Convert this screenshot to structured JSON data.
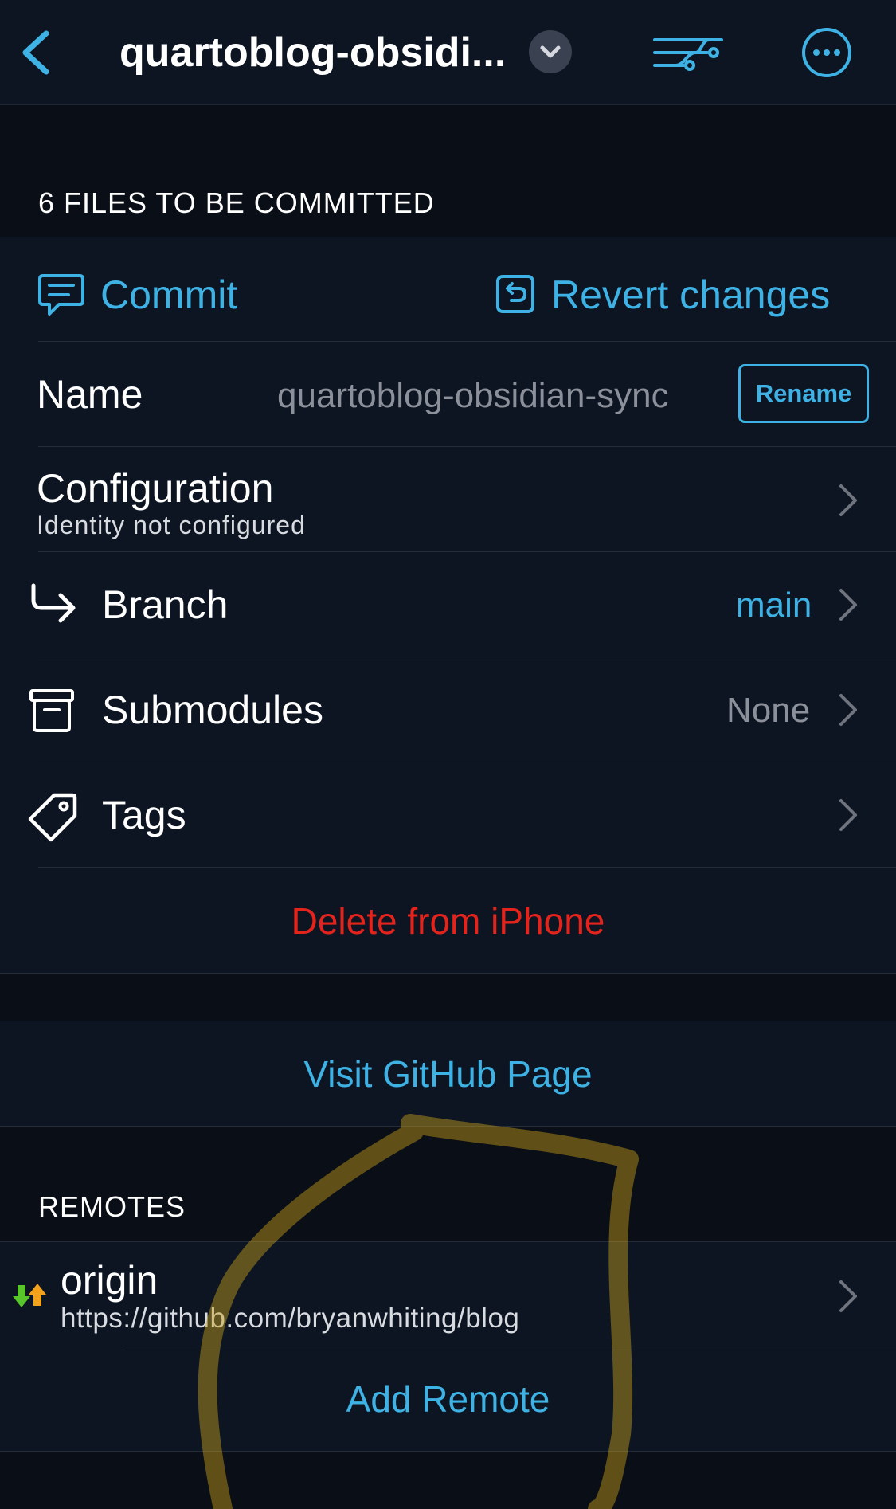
{
  "nav": {
    "title": "quartoblog-obsidi...",
    "back_icon": "chevron-left-icon",
    "dropdown_icon": "chevron-down-icon",
    "filter_icon": "git-filter-icon",
    "more_icon": "ellipsis-circle-icon"
  },
  "commit_section": {
    "header": "6 FILES TO BE COMMITTED",
    "commit_label": "Commit",
    "revert_label": "Revert changes"
  },
  "repo": {
    "name_label": "Name",
    "name_value": "quartoblog-obsidian-sync",
    "rename_label": "Rename",
    "configuration_label": "Configuration",
    "configuration_subtitle": "Identity not configured",
    "branch_label": "Branch",
    "branch_value": "main",
    "submodules_label": "Submodules",
    "submodules_value": "None",
    "tags_label": "Tags",
    "delete_label": "Delete from iPhone"
  },
  "github": {
    "visit_label": "Visit GitHub Page"
  },
  "remotes": {
    "header": "REMOTES",
    "items": [
      {
        "name": "origin",
        "url": "https://github.com/bryanwhiting/blog"
      }
    ],
    "add_label": "Add Remote"
  },
  "colors": {
    "accent": "#3eb2e4",
    "destructive": "#e3241c",
    "background": "#0a0e16",
    "card": "#0d1522",
    "annotation": "#c9a21a"
  }
}
